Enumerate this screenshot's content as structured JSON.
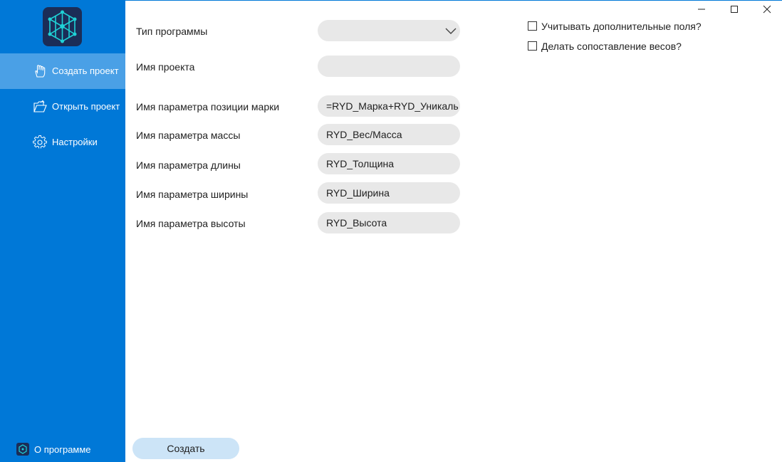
{
  "sidebar": {
    "items": [
      {
        "label": "Создать проект",
        "icon": "hand-pointer-icon",
        "active": true
      },
      {
        "label": "Открыть проект",
        "icon": "folder-open-icon",
        "active": false
      },
      {
        "label": "Настройки",
        "icon": "gear-icon",
        "active": false
      }
    ],
    "about_label": "О программе"
  },
  "form": {
    "program_type_label": "Тип программы",
    "program_type_value": "",
    "project_name_label": "Имя проекта",
    "project_name_value": "",
    "mark_param_label": "Имя параметра позиции марки",
    "mark_param_value": "=RYD_Марка+RYD_Уникаль",
    "mass_param_label": "Имя параметра массы",
    "mass_param_value": "RYD_Вес/Масса",
    "length_param_label": "Имя параметра длины",
    "length_param_value": "RYD_Толщина",
    "width_param_label": "Имя параметра ширины",
    "width_param_value": "RYD_Ширина",
    "height_param_label": "Имя параметра высоты",
    "height_param_value": "RYD_Высота"
  },
  "options": {
    "extra_fields_label": "Учитывать дополнительные поля?",
    "extra_fields_checked": false,
    "weights_label": "Делать сопоставление весов?",
    "weights_checked": false
  },
  "actions": {
    "create_label": "Создать"
  },
  "colors": {
    "sidebar": "#0078d7",
    "sidebar_active": "#4aa0e6",
    "logo_bg": "#1b2d57",
    "logo_accent": "#1fd1d6",
    "field_bg": "#e8e8e8",
    "button_bg": "#cce4f7"
  }
}
